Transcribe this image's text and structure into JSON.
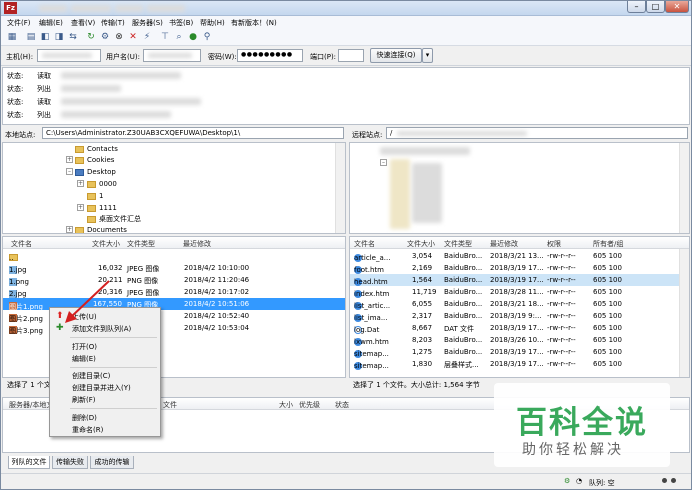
{
  "menu": [
    "文件(F)",
    "编辑(E)",
    "查看(V)",
    "传输(T)",
    "服务器(S)",
    "书签(B)",
    "帮助(H)",
    "有新版本！(N)"
  ],
  "quickconnect": {
    "host_label": "主机(H):",
    "user_label": "用户名(U):",
    "pass_label": "密码(W):",
    "pass_value": "●●●●●●●●●",
    "port_label": "端口(P):",
    "connect_label": "快速连接(Q)"
  },
  "log": [
    {
      "k": "状态:",
      "v": "读取"
    },
    {
      "k": "状态:",
      "v": "列出"
    },
    {
      "k": "状态:",
      "v": "读取"
    },
    {
      "k": "状态:",
      "v": "列出"
    }
  ],
  "local": {
    "label": "本地站点:",
    "path": "C:\\Users\\Administrator.Z30UAB3CXQEFUWA\\Desktop\\1\\",
    "tree": [
      "Contacts",
      "Cookies",
      "Desktop",
      "0000",
      "1",
      "1111",
      "桌面文件汇总",
      "Documents"
    ],
    "headers": [
      "文件名",
      "文件大小",
      "文件类型",
      "最近修改"
    ],
    "files": [
      {
        "name": "..",
        "size": "",
        "type": "",
        "date": ""
      },
      {
        "name": "1.jpg",
        "size": "16,032",
        "type": "JPEG 图像",
        "date": "2018/4/2 10:10:00"
      },
      {
        "name": "1.png",
        "size": "20,211",
        "type": "PNG 图像",
        "date": "2018/4/2 11:20:46"
      },
      {
        "name": "2.jpg",
        "size": "20,316",
        "type": "JPEG 图像",
        "date": "2018/4/2 10:17:02"
      },
      {
        "name": "图片1.png",
        "size": "167,550",
        "type": "PNG 图像",
        "date": "2018/4/2 10:51:06"
      },
      {
        "name": "图片2.png",
        "size": "",
        "type": "",
        "date": "2018/4/2 10:52:40"
      },
      {
        "name": "图片3.png",
        "size": "",
        "type": "",
        "date": "2018/4/2 10:53:04"
      }
    ],
    "status": "选择了 1 个文"
  },
  "remote": {
    "label": "远程站点:",
    "path": "/",
    "headers": [
      "文件名",
      "文件大小",
      "文件类型",
      "最近修改",
      "权限",
      "所有者/组"
    ],
    "files": [
      {
        "name": "article_a...",
        "size": "3,054",
        "type": "BaiduBro...",
        "date": "2018/3/21 13...",
        "perm": "-rw-r--r--",
        "owner": "605 100"
      },
      {
        "name": "foot.htm",
        "size": "2,169",
        "type": "BaiduBro...",
        "date": "2018/3/19 17...",
        "perm": "-rw-r--r--",
        "owner": "605 100"
      },
      {
        "name": "head.htm",
        "size": "1,564",
        "type": "BaiduBro...",
        "date": "2018/3/19 17...",
        "perm": "-rw-r--r--",
        "owner": "605 100"
      },
      {
        "name": "index.htm",
        "size": "11,719",
        "type": "BaiduBro...",
        "date": "2018/3/28 11...",
        "perm": "-rw-r--r--",
        "owner": "605 100"
      },
      {
        "name": "list_artic...",
        "size": "6,055",
        "type": "BaiduBro...",
        "date": "2018/3/21 18...",
        "perm": "-rw-r--r--",
        "owner": "605 100"
      },
      {
        "name": "list_ima...",
        "size": "2,317",
        "type": "BaiduBro...",
        "date": "2018/3/19 9:...",
        "perm": "-rw-r--r--",
        "owner": "605 100"
      },
      {
        "name": "log.Dat",
        "size": "8,667",
        "type": "DAT 文件",
        "date": "2018/3/19 17...",
        "perm": "-rw-r--r--",
        "owner": "605 100"
      },
      {
        "name": "lxwm.htm",
        "size": "8,203",
        "type": "BaiduBro...",
        "date": "2018/3/26 10...",
        "perm": "-rw-r--r--",
        "owner": "605 100"
      },
      {
        "name": "sitemap...",
        "size": "1,275",
        "type": "BaiduBro...",
        "date": "2018/3/19 17...",
        "perm": "-rw-r--r--",
        "owner": "605 100"
      },
      {
        "name": "sitemap...",
        "size": "1,830",
        "type": "层叠样式...",
        "date": "2018/3/19 17...",
        "perm": "-rw-r--r--",
        "owner": "605 100"
      }
    ],
    "status": "选择了 1 个文件。大小总计: 1,564 字节"
  },
  "queue_headers": [
    "服务器/本地文",
    "文件",
    "大小",
    "优先级",
    "状态"
  ],
  "tabs": [
    "列队的文件",
    "传输失败",
    "成功的传输"
  ],
  "queue_status": "队列: 空",
  "context_menu": [
    "上传(U)",
    "添加文件到队列(A)",
    "打开(O)",
    "编辑(E)",
    "创建目录(C)",
    "创建目录并进入(Y)",
    "刷新(F)",
    "删除(D)",
    "重命名(R)"
  ],
  "watermark": {
    "title": "百科全说",
    "subtitle": "助你轻松解决"
  }
}
